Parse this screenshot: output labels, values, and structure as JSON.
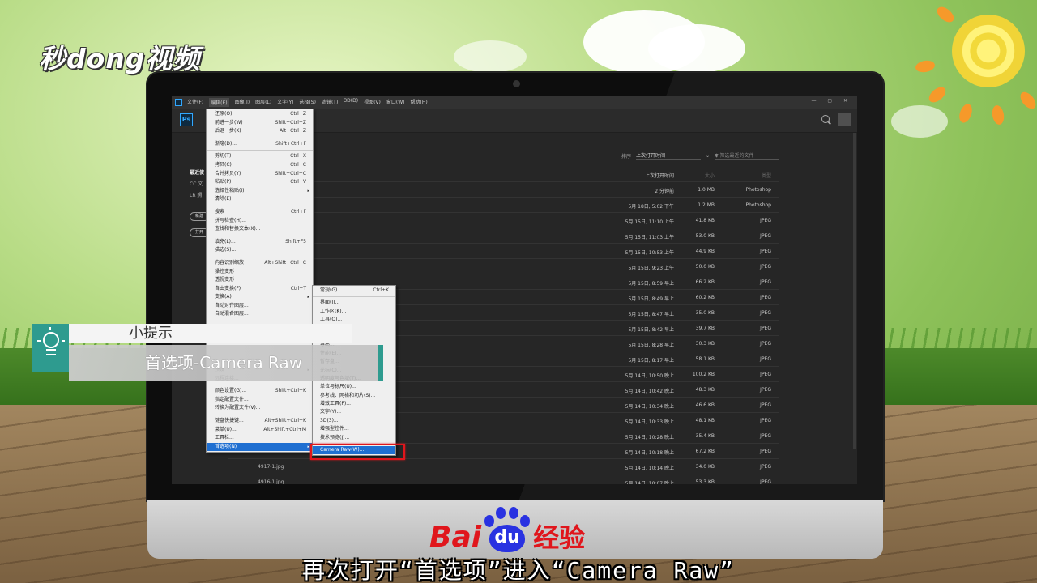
{
  "brand": {
    "logo_text": "秒dong视频",
    "baidu_left": "Bai",
    "baidu_paw": "du",
    "baidu_right": "经验"
  },
  "subtitle": "再次打开“首选项”进入“Camera Raw”",
  "tip": {
    "title": "小提示",
    "body": "首选项-Camera Raw"
  },
  "app": {
    "menubar": [
      "文件(F)",
      "编辑(E)",
      "图像(I)",
      "图层(L)",
      "文字(Y)",
      "选择(S)",
      "滤镜(T)",
      "3D(D)",
      "视图(V)",
      "窗口(W)",
      "帮助(H)"
    ],
    "ps_logo": "Ps",
    "left_panel": {
      "recent": "最近使",
      "cc": "CC 文",
      "lr": "LR 照",
      "new_button": "新建",
      "open_button": "打开"
    },
    "sort": {
      "label": "排序",
      "value": "上次打开时间"
    },
    "filter_placeholder": "筛选最近的文件",
    "table": {
      "headers": {
        "time": "上次打开时间",
        "size": "大小",
        "type": "类型"
      },
      "rows": [
        {
          "name": "",
          "time": "2 分钟前",
          "size": "1.0 MB",
          "type": "Photoshop"
        },
        {
          "name": "",
          "time": "5月 18日, 5:02 下午",
          "size": "1.2 MB",
          "type": "Photoshop"
        },
        {
          "name": "",
          "time": "5月 15日, 11:10 上午",
          "size": "41.8 KB",
          "type": "JPEG"
        },
        {
          "name": "",
          "time": "5月 15日, 11:03 上午",
          "size": "53.0 KB",
          "type": "JPEG"
        },
        {
          "name": "",
          "time": "5月 15日, 10:53 上午",
          "size": "44.9 KB",
          "type": "JPEG"
        },
        {
          "name": "",
          "time": "5月 15日, 9:23 上午",
          "size": "50.0 KB",
          "type": "JPEG"
        },
        {
          "name": "",
          "time": "5月 15日, 8:59 早上",
          "size": "66.2 KB",
          "type": "JPEG"
        },
        {
          "name": "",
          "time": "5月 15日, 8:49 早上",
          "size": "60.2 KB",
          "type": "JPEG"
        },
        {
          "name": "",
          "time": "5月 15日, 8:47 早上",
          "size": "35.0 KB",
          "type": "JPEG"
        },
        {
          "name": "",
          "time": "5月 15日, 8:42 早上",
          "size": "39.7 KB",
          "type": "JPEG"
        },
        {
          "name": "",
          "time": "5月 15日, 8:28 早上",
          "size": "30.3 KB",
          "type": "JPEG"
        },
        {
          "name": "",
          "time": "5月 15日, 8:17 早上",
          "size": "58.1 KB",
          "type": "JPEG"
        },
        {
          "name": "",
          "time": "5月 14日, 10:50 晚上",
          "size": "100.2 KB",
          "type": "JPEG"
        },
        {
          "name": "",
          "time": "5月 14日, 10:42 晚上",
          "size": "48.3 KB",
          "type": "JPEG"
        },
        {
          "name": "",
          "time": "5月 14日, 10:34 晚上",
          "size": "46.6 KB",
          "type": "JPEG"
        },
        {
          "name": "",
          "time": "5月 14日, 10:33 晚上",
          "size": "48.1 KB",
          "type": "JPEG"
        },
        {
          "name": "",
          "time": "5月 14日, 10:28 晚上",
          "size": "35.4 KB",
          "type": "JPEG"
        },
        {
          "name": "",
          "time": "5月 14日, 10:18 晚上",
          "size": "67.2 KB",
          "type": "JPEG"
        },
        {
          "name": "4917-1.jpg",
          "time": "5月 14日, 10:14 晚上",
          "size": "34.0 KB",
          "type": "JPEG"
        },
        {
          "name": "4916-1.jpg",
          "time": "5月 14日, 10:07 晚上",
          "size": "53.3 KB",
          "type": "JPEG"
        }
      ]
    },
    "edit_menu": [
      {
        "label": "还原(O)",
        "shortcut": "Ctrl+Z"
      },
      {
        "label": "前进一步(W)",
        "shortcut": "Shift+Ctrl+Z"
      },
      {
        "label": "后退一步(K)",
        "shortcut": "Alt+Ctrl+Z"
      },
      {
        "sep": true
      },
      {
        "label": "渐隐(D)...",
        "shortcut": "Shift+Ctrl+F"
      },
      {
        "sep": true
      },
      {
        "label": "剪切(T)",
        "shortcut": "Ctrl+X"
      },
      {
        "label": "拷贝(C)",
        "shortcut": "Ctrl+C"
      },
      {
        "label": "合并拷贝(Y)",
        "shortcut": "Shift+Ctrl+C"
      },
      {
        "label": "粘贴(P)",
        "shortcut": "Ctrl+V"
      },
      {
        "label": "选择性粘贴(I)",
        "shortcut": "",
        "submenu": true
      },
      {
        "label": "清除(E)",
        "shortcut": ""
      },
      {
        "sep": true
      },
      {
        "label": "搜索",
        "shortcut": "Ctrl+F"
      },
      {
        "label": "拼写检查(H)...",
        "shortcut": ""
      },
      {
        "label": "查找和替换文本(X)...",
        "shortcut": ""
      },
      {
        "sep": true
      },
      {
        "label": "填充(L)...",
        "shortcut": "Shift+F5"
      },
      {
        "label": "描边(S)...",
        "shortcut": ""
      },
      {
        "sep": true
      },
      {
        "label": "内容识别缩放",
        "shortcut": "Alt+Shift+Ctrl+C"
      },
      {
        "label": "操控变形",
        "shortcut": ""
      },
      {
        "label": "透视变形",
        "shortcut": ""
      },
      {
        "label": "自由变换(F)",
        "shortcut": "Ctrl+T"
      },
      {
        "label": "变换(A)",
        "shortcut": "",
        "submenu": true
      },
      {
        "label": "自动对齐图层...",
        "shortcut": ""
      },
      {
        "label": "自动混合图层...",
        "shortcut": ""
      },
      {
        "sep": true
      },
      {
        "label": "",
        "shortcut": ""
      },
      {
        "label": "",
        "shortcut": ""
      },
      {
        "label": "",
        "shortcut": ""
      },
      {
        "label": "",
        "shortcut": ""
      },
      {
        "label": "",
        "shortcut": ""
      },
      {
        "label": "预设",
        "shortcut": "",
        "submenu": true
      },
      {
        "label": "远程连接...",
        "shortcut": ""
      },
      {
        "sep": true
      },
      {
        "label": "颜色设置(G)...",
        "shortcut": "Shift+Ctrl+K"
      },
      {
        "label": "指定配置文件...",
        "shortcut": ""
      },
      {
        "label": "转换为配置文件(V)...",
        "shortcut": ""
      },
      {
        "sep": true
      },
      {
        "label": "键盘快捷键...",
        "shortcut": "Alt+Shift+Ctrl+K"
      },
      {
        "label": "菜单(U)...",
        "shortcut": "Alt+Shift+Ctrl+M"
      },
      {
        "label": "工具栏...",
        "shortcut": ""
      },
      {
        "label": "首选项(N)",
        "shortcut": "",
        "submenu": true,
        "highlight": true
      }
    ],
    "prefs_menu": [
      {
        "label": "常规(G)...",
        "shortcut": "Ctrl+K"
      },
      {
        "sep": true
      },
      {
        "label": "界面(I)..."
      },
      {
        "label": "工作区(K)..."
      },
      {
        "label": "工具(O)..."
      },
      {
        "label": "历史记录(H)..."
      },
      {
        "label": "文件处理(F)..."
      },
      {
        "label": "导出..."
      },
      {
        "label": "性能(E)..."
      },
      {
        "label": "暂存盘..."
      },
      {
        "label": "光标(C)..."
      },
      {
        "label": "透明度与色域(T)..."
      },
      {
        "label": "单位与标尺(U)..."
      },
      {
        "label": "参考线、网格和切片(S)..."
      },
      {
        "label": "增效工具(P)..."
      },
      {
        "label": "文字(Y)..."
      },
      {
        "label": "3D(3)..."
      },
      {
        "label": "增强型控件..."
      },
      {
        "label": "技术预览(J)..."
      },
      {
        "sep": true
      },
      {
        "label": "Camera Raw(W)...",
        "highlight": true
      }
    ]
  }
}
